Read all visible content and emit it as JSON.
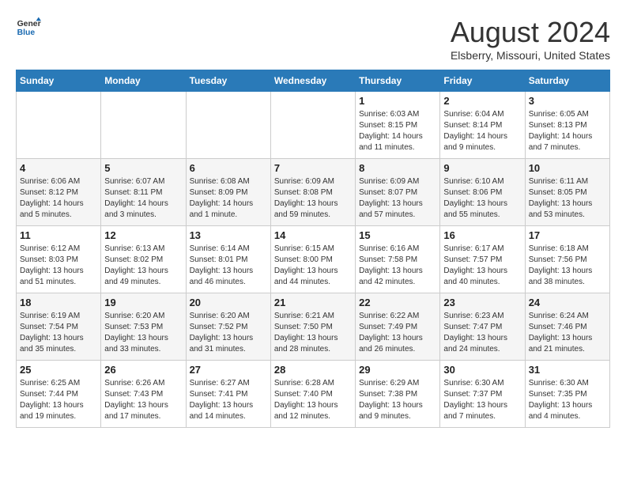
{
  "header": {
    "logo_general": "General",
    "logo_blue": "Blue",
    "month": "August 2024",
    "location": "Elsberry, Missouri, United States"
  },
  "days_of_week": [
    "Sunday",
    "Monday",
    "Tuesday",
    "Wednesday",
    "Thursday",
    "Friday",
    "Saturday"
  ],
  "weeks": [
    [
      {
        "day": "",
        "info": ""
      },
      {
        "day": "",
        "info": ""
      },
      {
        "day": "",
        "info": ""
      },
      {
        "day": "",
        "info": ""
      },
      {
        "day": "1",
        "info": "Sunrise: 6:03 AM\nSunset: 8:15 PM\nDaylight: 14 hours\nand 11 minutes."
      },
      {
        "day": "2",
        "info": "Sunrise: 6:04 AM\nSunset: 8:14 PM\nDaylight: 14 hours\nand 9 minutes."
      },
      {
        "day": "3",
        "info": "Sunrise: 6:05 AM\nSunset: 8:13 PM\nDaylight: 14 hours\nand 7 minutes."
      }
    ],
    [
      {
        "day": "4",
        "info": "Sunrise: 6:06 AM\nSunset: 8:12 PM\nDaylight: 14 hours\nand 5 minutes."
      },
      {
        "day": "5",
        "info": "Sunrise: 6:07 AM\nSunset: 8:11 PM\nDaylight: 14 hours\nand 3 minutes."
      },
      {
        "day": "6",
        "info": "Sunrise: 6:08 AM\nSunset: 8:09 PM\nDaylight: 14 hours\nand 1 minute."
      },
      {
        "day": "7",
        "info": "Sunrise: 6:09 AM\nSunset: 8:08 PM\nDaylight: 13 hours\nand 59 minutes."
      },
      {
        "day": "8",
        "info": "Sunrise: 6:09 AM\nSunset: 8:07 PM\nDaylight: 13 hours\nand 57 minutes."
      },
      {
        "day": "9",
        "info": "Sunrise: 6:10 AM\nSunset: 8:06 PM\nDaylight: 13 hours\nand 55 minutes."
      },
      {
        "day": "10",
        "info": "Sunrise: 6:11 AM\nSunset: 8:05 PM\nDaylight: 13 hours\nand 53 minutes."
      }
    ],
    [
      {
        "day": "11",
        "info": "Sunrise: 6:12 AM\nSunset: 8:03 PM\nDaylight: 13 hours\nand 51 minutes."
      },
      {
        "day": "12",
        "info": "Sunrise: 6:13 AM\nSunset: 8:02 PM\nDaylight: 13 hours\nand 49 minutes."
      },
      {
        "day": "13",
        "info": "Sunrise: 6:14 AM\nSunset: 8:01 PM\nDaylight: 13 hours\nand 46 minutes."
      },
      {
        "day": "14",
        "info": "Sunrise: 6:15 AM\nSunset: 8:00 PM\nDaylight: 13 hours\nand 44 minutes."
      },
      {
        "day": "15",
        "info": "Sunrise: 6:16 AM\nSunset: 7:58 PM\nDaylight: 13 hours\nand 42 minutes."
      },
      {
        "day": "16",
        "info": "Sunrise: 6:17 AM\nSunset: 7:57 PM\nDaylight: 13 hours\nand 40 minutes."
      },
      {
        "day": "17",
        "info": "Sunrise: 6:18 AM\nSunset: 7:56 PM\nDaylight: 13 hours\nand 38 minutes."
      }
    ],
    [
      {
        "day": "18",
        "info": "Sunrise: 6:19 AM\nSunset: 7:54 PM\nDaylight: 13 hours\nand 35 minutes."
      },
      {
        "day": "19",
        "info": "Sunrise: 6:20 AM\nSunset: 7:53 PM\nDaylight: 13 hours\nand 33 minutes."
      },
      {
        "day": "20",
        "info": "Sunrise: 6:20 AM\nSunset: 7:52 PM\nDaylight: 13 hours\nand 31 minutes."
      },
      {
        "day": "21",
        "info": "Sunrise: 6:21 AM\nSunset: 7:50 PM\nDaylight: 13 hours\nand 28 minutes."
      },
      {
        "day": "22",
        "info": "Sunrise: 6:22 AM\nSunset: 7:49 PM\nDaylight: 13 hours\nand 26 minutes."
      },
      {
        "day": "23",
        "info": "Sunrise: 6:23 AM\nSunset: 7:47 PM\nDaylight: 13 hours\nand 24 minutes."
      },
      {
        "day": "24",
        "info": "Sunrise: 6:24 AM\nSunset: 7:46 PM\nDaylight: 13 hours\nand 21 minutes."
      }
    ],
    [
      {
        "day": "25",
        "info": "Sunrise: 6:25 AM\nSunset: 7:44 PM\nDaylight: 13 hours\nand 19 minutes."
      },
      {
        "day": "26",
        "info": "Sunrise: 6:26 AM\nSunset: 7:43 PM\nDaylight: 13 hours\nand 17 minutes."
      },
      {
        "day": "27",
        "info": "Sunrise: 6:27 AM\nSunset: 7:41 PM\nDaylight: 13 hours\nand 14 minutes."
      },
      {
        "day": "28",
        "info": "Sunrise: 6:28 AM\nSunset: 7:40 PM\nDaylight: 13 hours\nand 12 minutes."
      },
      {
        "day": "29",
        "info": "Sunrise: 6:29 AM\nSunset: 7:38 PM\nDaylight: 13 hours\nand 9 minutes."
      },
      {
        "day": "30",
        "info": "Sunrise: 6:30 AM\nSunset: 7:37 PM\nDaylight: 13 hours\nand 7 minutes."
      },
      {
        "day": "31",
        "info": "Sunrise: 6:30 AM\nSunset: 7:35 PM\nDaylight: 13 hours\nand 4 minutes."
      }
    ]
  ]
}
